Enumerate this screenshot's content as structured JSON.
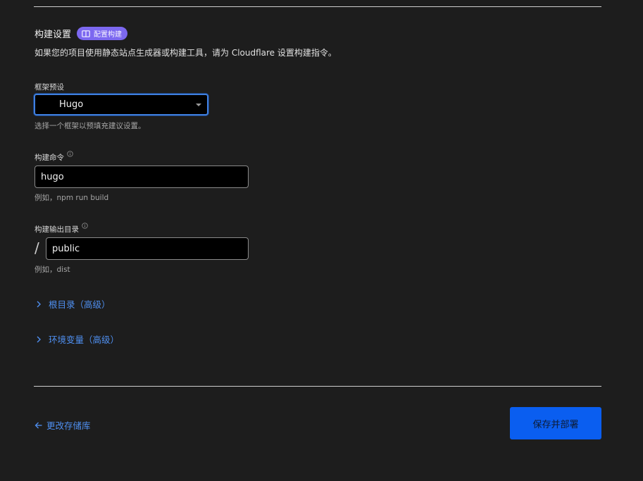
{
  "build_settings": {
    "title": "构建设置",
    "badge_label": "配置构建",
    "badge_icon": "book-icon",
    "description": "如果您的项目使用静态站点生成器或构建工具，请为 Cloudflare 设置构建指令。"
  },
  "framework_preset": {
    "label": "框架预设",
    "selected_value": "Hugo",
    "hint": "选择一个框架以预填充建议设置。"
  },
  "build_command": {
    "label": "构建命令",
    "value": "hugo",
    "hint": "例如，npm run build",
    "info_icon": "info-icon"
  },
  "build_output": {
    "label": "构建输出目录",
    "prefix": "/",
    "value": "public",
    "hint": "例如，dist",
    "info_icon": "info-icon"
  },
  "advanced": {
    "root_directory_label": "根目录（高级）",
    "env_vars_label": "环境变量（高级）"
  },
  "footer": {
    "back_label": "更改存储库",
    "save_deploy_label": "保存并部署"
  },
  "colors": {
    "background": "#1d1d1d",
    "accent_link": "#4f8ff0",
    "badge": "#7c68f0",
    "primary_button": "#0a5ef0",
    "focus_ring": "#3f7fe0"
  }
}
